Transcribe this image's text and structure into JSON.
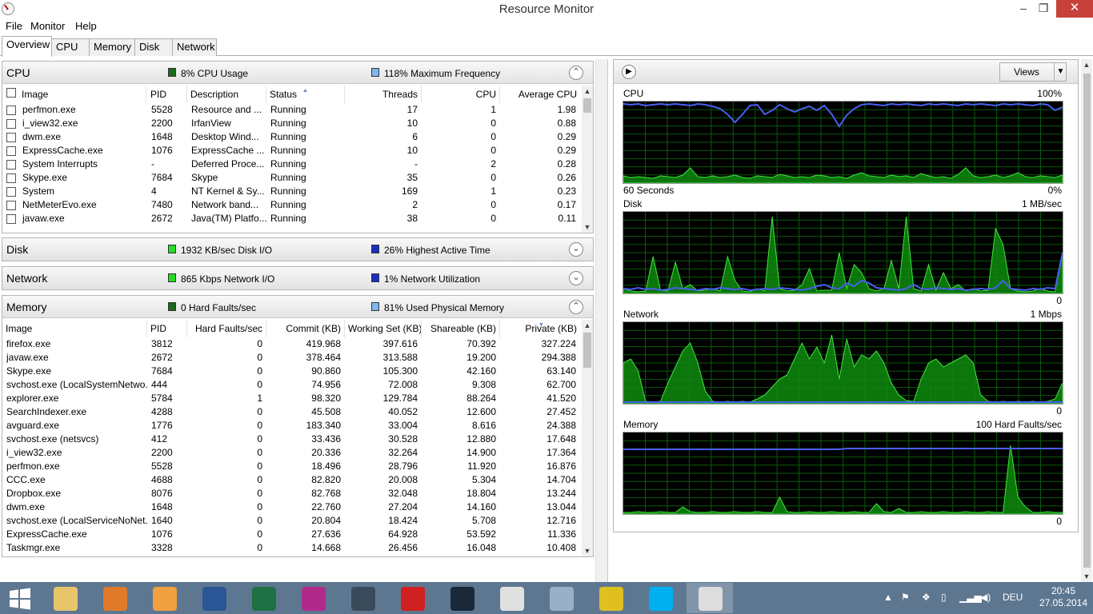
{
  "window": {
    "title": "Resource Monitor",
    "minimize": "–",
    "maximize": "❐",
    "close": "✕"
  },
  "menu": [
    "File",
    "Monitor",
    "Help"
  ],
  "tabs": [
    "Overview",
    "CPU",
    "Memory",
    "Disk",
    "Network"
  ],
  "cpu": {
    "title": "CPU",
    "ind1": {
      "text": "8% CPU Usage",
      "color": "#1b6a1b"
    },
    "ind2": {
      "text": "118% Maximum Frequency",
      "color": "#7fb6f2"
    },
    "chevron": "⌃",
    "headers": [
      "Image",
      "PID",
      "Description",
      "Status",
      "Threads",
      "CPU",
      "Average CPU"
    ],
    "rows": [
      [
        "perfmon.exe",
        "5528",
        "Resource and ...",
        "Running",
        "17",
        "1",
        "1.98"
      ],
      [
        "i_view32.exe",
        "2200",
        "IrfanView",
        "Running",
        "10",
        "0",
        "0.88"
      ],
      [
        "dwm.exe",
        "1648",
        "Desktop Wind...",
        "Running",
        "6",
        "0",
        "0.29"
      ],
      [
        "ExpressCache.exe",
        "1076",
        "ExpressCache ...",
        "Running",
        "10",
        "0",
        "0.29"
      ],
      [
        "System Interrupts",
        "-",
        "Deferred Proce...",
        "Running",
        "-",
        "2",
        "0.28"
      ],
      [
        "Skype.exe",
        "7684",
        "Skype",
        "Running",
        "35",
        "0",
        "0.26"
      ],
      [
        "System",
        "4",
        "NT Kernel & Sy...",
        "Running",
        "169",
        "1",
        "0.23"
      ],
      [
        "NetMeterEvo.exe",
        "7480",
        "Network band...",
        "Running",
        "2",
        "0",
        "0.17"
      ],
      [
        "javaw.exe",
        "2672",
        "Java(TM) Platfo...",
        "Running",
        "38",
        "0",
        "0.11"
      ]
    ]
  },
  "disk": {
    "title": "Disk",
    "ind1": {
      "text": "1932 KB/sec Disk I/O",
      "color": "#22dd22"
    },
    "ind2": {
      "text": "26% Highest Active Time",
      "color": "#1a2fc0"
    },
    "chevron": "⌄"
  },
  "network": {
    "title": "Network",
    "ind1": {
      "text": "865 Kbps Network I/O",
      "color": "#22dd22"
    },
    "ind2": {
      "text": "1% Network Utilization",
      "color": "#1a2fc0"
    },
    "chevron": "⌄"
  },
  "memory": {
    "title": "Memory",
    "ind1": {
      "text": "0 Hard Faults/sec",
      "color": "#1b6a1b"
    },
    "ind2": {
      "text": "81% Used Physical Memory",
      "color": "#7fb6f2"
    },
    "chevron": "⌃",
    "headers": [
      "Image",
      "PID",
      "Hard Faults/sec",
      "Commit (KB)",
      "Working Set (KB)",
      "Shareable (KB)",
      "Private (KB)"
    ],
    "rows": [
      [
        "firefox.exe",
        "3812",
        "0",
        "419.968",
        "397.616",
        "70.392",
        "327.224"
      ],
      [
        "javaw.exe",
        "2672",
        "0",
        "378.464",
        "313.588",
        "19.200",
        "294.388"
      ],
      [
        "Skype.exe",
        "7684",
        "0",
        "90.860",
        "105.300",
        "42.160",
        "63.140"
      ],
      [
        "svchost.exe (LocalSystemNetwo...",
        "444",
        "0",
        "74.956",
        "72.008",
        "9.308",
        "62.700"
      ],
      [
        "explorer.exe",
        "5784",
        "1",
        "98.320",
        "129.784",
        "88.264",
        "41.520"
      ],
      [
        "SearchIndexer.exe",
        "4288",
        "0",
        "45.508",
        "40.052",
        "12.600",
        "27.452"
      ],
      [
        "avguard.exe",
        "1776",
        "0",
        "183.340",
        "33.004",
        "8.616",
        "24.388"
      ],
      [
        "svchost.exe (netsvcs)",
        "412",
        "0",
        "33.436",
        "30.528",
        "12.880",
        "17.648"
      ],
      [
        "i_view32.exe",
        "2200",
        "0",
        "20.336",
        "32.264",
        "14.900",
        "17.364"
      ],
      [
        "perfmon.exe",
        "5528",
        "0",
        "18.496",
        "28.796",
        "11.920",
        "16.876"
      ],
      [
        "CCC.exe",
        "4688",
        "0",
        "82.820",
        "20.008",
        "5.304",
        "14.704"
      ],
      [
        "Dropbox.exe",
        "8076",
        "0",
        "82.768",
        "32.048",
        "18.804",
        "13.244"
      ],
      [
        "dwm.exe",
        "1648",
        "0",
        "22.760",
        "27.204",
        "14.160",
        "13.044"
      ],
      [
        "svchost.exe (LocalServiceNoNet...",
        "1640",
        "0",
        "20.804",
        "18.424",
        "5.708",
        "12.716"
      ],
      [
        "ExpressCache.exe",
        "1076",
        "0",
        "27.636",
        "64.928",
        "53.592",
        "11.336"
      ],
      [
        "Taskmgr.exe",
        "3328",
        "0",
        "14.668",
        "26.456",
        "16.048",
        "10.408"
      ]
    ]
  },
  "right": {
    "views": "Views",
    "graphs": [
      {
        "name": "CPU",
        "max": "100%",
        "bottom_left": "60 Seconds",
        "bottom_right": "0%"
      },
      {
        "name": "Disk",
        "max": "1 MB/sec",
        "bottom_right": "0"
      },
      {
        "name": "Network",
        "max": "1 Mbps",
        "bottom_right": "0"
      },
      {
        "name": "Memory",
        "max": "100 Hard Faults/sec",
        "bottom_right": "0"
      }
    ]
  },
  "chart_data": [
    {
      "type": "area",
      "title": "CPU",
      "ylim": [
        0,
        100
      ],
      "series": [
        {
          "values": [
            8,
            6,
            7,
            6,
            5,
            8,
            7,
            6,
            9,
            18,
            7,
            6,
            8,
            6,
            7,
            9,
            6,
            5,
            8,
            7,
            6,
            10,
            8,
            6,
            7,
            6,
            9,
            8,
            6,
            7,
            5,
            9,
            12,
            8,
            7,
            6,
            9,
            7,
            8,
            6,
            11,
            8,
            6,
            7,
            5,
            10,
            18,
            8,
            6,
            7,
            9,
            6,
            8,
            12,
            7,
            6,
            8,
            7,
            6,
            9
          ]
        },
        {
          "values": [
            98,
            97,
            98,
            96,
            97,
            98,
            97,
            98,
            97,
            96,
            98,
            97,
            95,
            92,
            85,
            75,
            85,
            96,
            97,
            85,
            90,
            97,
            92,
            88,
            92,
            95,
            90,
            96,
            85,
            70,
            84,
            92,
            97,
            98,
            97,
            96,
            98,
            97,
            98,
            97,
            96,
            98,
            97,
            98,
            97,
            96,
            98,
            97,
            98,
            97,
            96,
            98,
            97,
            98,
            97,
            96,
            98,
            97,
            90,
            94
          ]
        }
      ]
    },
    {
      "type": "area",
      "title": "Disk",
      "ylim": [
        0,
        1
      ],
      "series": [
        {
          "values": [
            0.05,
            0.02,
            0.01,
            0.02,
            0.45,
            0.03,
            0.02,
            0.38,
            0.05,
            0.1,
            0.02,
            0.03,
            0.05,
            0.02,
            0.45,
            0.15,
            0.02,
            0.01,
            0.05,
            0.02,
            0.95,
            0.05,
            0.02,
            0.03,
            0.1,
            0.3,
            0.02,
            0.03,
            0.03,
            0.5,
            0.05,
            0.35,
            0.25,
            0.05,
            0.02,
            0.05,
            0.4,
            0.05,
            0.95,
            0.05,
            0.02,
            0.35,
            0.03,
            0.25,
            0.05,
            0.1,
            0.02,
            0.05,
            0.02,
            0.03,
            0.8,
            0.6,
            0.05,
            0.02,
            0.01,
            0.02,
            0.05,
            0.02,
            0.01,
            0.5
          ]
        },
        {
          "values": [
            0.05,
            0.04,
            0.06,
            0.04,
            0.05,
            0.03,
            0.04,
            0.06,
            0.05,
            0.04,
            0.03,
            0.05,
            0.04,
            0.06,
            0.05,
            0.04,
            0.05,
            0.03,
            0.04,
            0.05,
            0.04,
            0.06,
            0.05,
            0.04,
            0.03,
            0.05,
            0.08,
            0.1,
            0.06,
            0.05,
            0.12,
            0.08,
            0.15,
            0.12,
            0.06,
            0.05,
            0.04,
            0.03,
            0.05,
            0.1,
            0.05,
            0.04,
            0.06,
            0.05,
            0.04,
            0.05,
            0.03,
            0.04,
            0.05,
            0.04,
            0.06,
            0.15,
            0.05,
            0.04,
            0.03,
            0.05,
            0.04,
            0.06,
            0.05,
            0.5
          ]
        }
      ]
    },
    {
      "type": "area",
      "title": "Network",
      "ylim": [
        0,
        1
      ],
      "series": [
        {
          "values": [
            0.5,
            0.55,
            0.4,
            0.02,
            0.01,
            0.02,
            0.25,
            0.45,
            0.65,
            0.75,
            0.5,
            0.15,
            0.02,
            0.01,
            0.02,
            0.01,
            0.02,
            0.01,
            0.05,
            0.1,
            0.2,
            0.3,
            0.35,
            0.55,
            0.75,
            0.55,
            0.7,
            0.5,
            0.85,
            0.3,
            0.8,
            0.45,
            0.6,
            0.55,
            0.65,
            0.5,
            0.25,
            0.1,
            0.03,
            0.02,
            0.3,
            0.5,
            0.55,
            0.45,
            0.5,
            0.55,
            0.6,
            0.5,
            0.1,
            0.02,
            0.01,
            0.02,
            0.01,
            0.02,
            0.01,
            0.02,
            0.01,
            0.02,
            0.05,
            0.25
          ]
        },
        {
          "values": [
            0.01,
            0.01,
            0.01,
            0.01,
            0.01,
            0.01,
            0.01,
            0.01,
            0.01,
            0.01,
            0.01,
            0.01,
            0.01,
            0.01,
            0.01,
            0.01,
            0.01,
            0.01,
            0.01,
            0.01,
            0.01,
            0.01,
            0.01,
            0.01,
            0.01,
            0.01,
            0.01,
            0.01,
            0.01,
            0.01,
            0.01,
            0.01,
            0.01,
            0.01,
            0.01,
            0.01,
            0.01,
            0.01,
            0.01,
            0.01,
            0.01,
            0.01,
            0.01,
            0.01,
            0.01,
            0.01,
            0.01,
            0.01,
            0.01,
            0.01,
            0.01,
            0.01,
            0.01,
            0.01,
            0.01,
            0.01,
            0.01,
            0.01,
            0.01,
            0.01
          ]
        }
      ]
    },
    {
      "type": "area",
      "title": "Memory",
      "ylim": [
        0,
        100
      ],
      "series": [
        {
          "values": [
            1,
            1,
            2,
            1,
            1,
            2,
            1,
            1,
            8,
            2,
            1,
            1,
            2,
            1,
            1,
            2,
            1,
            1,
            2,
            1,
            1,
            20,
            2,
            1,
            1,
            2,
            1,
            1,
            2,
            1,
            1,
            2,
            1,
            1,
            12,
            2,
            1,
            6,
            1,
            1,
            2,
            1,
            1,
            2,
            1,
            1,
            2,
            1,
            1,
            2,
            1,
            1,
            85,
            20,
            8,
            1,
            1,
            2,
            1,
            1
          ]
        },
        {
          "values": [
            80,
            80,
            80,
            80,
            80,
            80,
            80,
            80,
            80,
            80,
            80,
            80,
            80,
            80,
            80,
            80,
            80,
            80,
            80,
            80,
            80,
            80,
            80,
            80,
            80,
            80,
            80,
            80,
            80,
            80,
            81,
            81,
            81,
            81,
            81,
            81,
            81,
            81,
            81,
            81,
            81,
            81,
            81,
            81,
            81,
            81,
            81,
            81,
            81,
            81,
            81,
            81,
            81,
            81,
            81,
            81,
            81,
            81,
            81,
            81
          ]
        }
      ]
    }
  ],
  "taskbar": {
    "apps": [
      {
        "name": "explorer",
        "color": "#e8c56a"
      },
      {
        "name": "firefox",
        "color": "#e07a2a"
      },
      {
        "name": "outlook",
        "color": "#f0a040"
      },
      {
        "name": "word",
        "color": "#2b5797"
      },
      {
        "name": "excel",
        "color": "#1e7145"
      },
      {
        "name": "camera",
        "color": "#b02a8a"
      },
      {
        "name": "media",
        "color": "#3a4a5a"
      },
      {
        "name": "paint-splat",
        "color": "#d02020"
      },
      {
        "name": "steam",
        "color": "#1b2838"
      },
      {
        "name": "fox-mask",
        "color": "#e0e0e0"
      },
      {
        "name": "monitor",
        "color": "#9ab0c8"
      },
      {
        "name": "globe",
        "color": "#e0c020"
      },
      {
        "name": "skype",
        "color": "#00aff0"
      },
      {
        "name": "resmon",
        "color": "#dddddd"
      }
    ],
    "lang": "DEU",
    "time": "20:45",
    "date": "27.05.2014"
  }
}
